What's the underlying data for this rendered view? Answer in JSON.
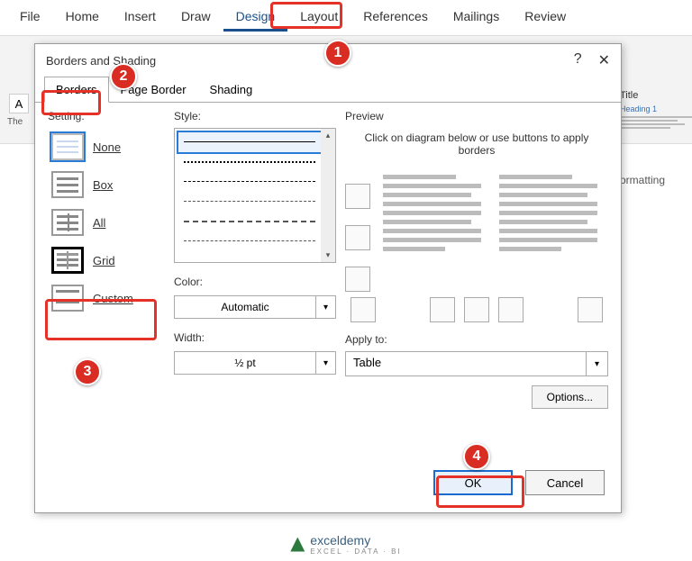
{
  "ribbon": {
    "tabs": [
      "File",
      "Home",
      "Insert",
      "Draw",
      "Design",
      "Layout",
      "References",
      "Mailings",
      "Review"
    ],
    "active": "Design"
  },
  "sidebar_peek": {
    "title": "Title",
    "heading": "Heading 1",
    "formatting": "ormatting"
  },
  "below_ribbon": {
    "themes_label": "The"
  },
  "dialog": {
    "title": "Borders and Shading",
    "help": "?",
    "close": "✕",
    "tabs": [
      "Borders",
      "Page Border",
      "Shading"
    ],
    "selected_tab": "Borders",
    "setting_label": "Setting:",
    "settings": [
      {
        "key": "none",
        "label": "None"
      },
      {
        "key": "box",
        "label": "Box"
      },
      {
        "key": "all",
        "label": "All"
      },
      {
        "key": "grid",
        "label": "Grid"
      },
      {
        "key": "custom",
        "label": "Custom"
      }
    ],
    "style_label": "Style:",
    "color_label": "Color:",
    "color_value": "Automatic",
    "width_label": "Width:",
    "width_value": "½ pt",
    "preview_label": "Preview",
    "preview_hint": "Click on diagram below or use buttons to apply borders",
    "apply_label": "Apply to:",
    "apply_value": "Table",
    "options_label": "Options...",
    "ok_label": "OK",
    "cancel_label": "Cancel"
  },
  "callouts": {
    "c1": "1",
    "c2": "2",
    "c3": "3",
    "c4": "4"
  },
  "watermark": {
    "name": "exceldemy",
    "sub": "EXCEL · DATA · BI"
  }
}
